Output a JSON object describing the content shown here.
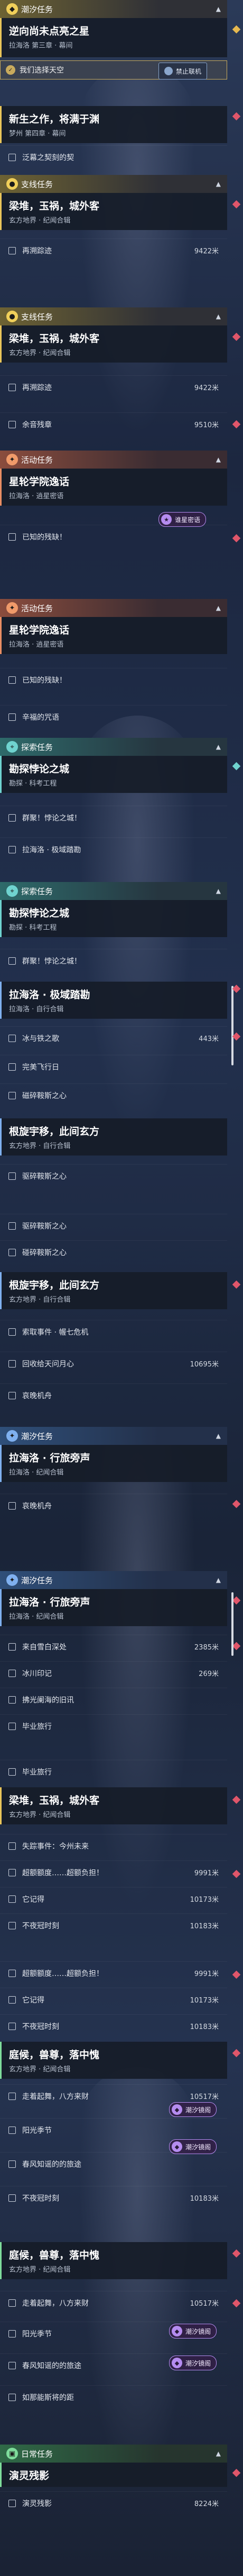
{
  "header_labels": {
    "main": "潮汐任务",
    "side": "支线任务",
    "event": "活动任务",
    "tidal": "潮汐任务",
    "explore": "探索任务",
    "daily": "日常任务"
  },
  "prohibited_label": "禁止联机",
  "tag_label": "谁星密语",
  "tide_tag_label": "潮汐镜阁",
  "quests": {
    "q1": {
      "title": "逆向尚未点亮之星",
      "sub": "拉海洛 第三章 · 幕间",
      "selected": "我们选择天空"
    },
    "q2": {
      "title": "新生之作，将满于渊",
      "sub": "梦州 第四章 · 幕间",
      "objs": [
        "泛幕之契刻的契"
      ]
    },
    "q3": {
      "title": "梁堆，玉祸，城外客",
      "sub": "玄方地界 · 纪闻合辑",
      "objs": [
        {
          "t": "再溯踪迹",
          "d": "9422米"
        }
      ]
    },
    "q4": {
      "title": "梁堆，玉祸，城外客",
      "sub": "玄方地界 · 纪闻合辑",
      "objs": [
        {
          "t": "再溯踪迹",
          "d": "9422米"
        },
        {
          "t": "余音残章",
          "d": "9510米"
        }
      ]
    },
    "q5": {
      "title": "星轮学院逸话",
      "sub": "拉海洛 · 逍星密语",
      "objs": [
        "已知的残缺！"
      ]
    },
    "q6": {
      "title": "星轮学院逸话",
      "sub": "拉海洛 · 逍星密语",
      "objs": [
        "已知的残缺！",
        "辛福的咒语"
      ]
    },
    "q7": {
      "title": "勘探悖论之城",
      "sub": "勘探 · 科考工程",
      "objs": [
        "群聚！悖论之城！",
        "拉海洛 · 极域踏勘"
      ]
    },
    "q8": {
      "title": "勘探悖论之城",
      "sub": "勘探 · 科考工程",
      "objs": [
        "群聚！悖论之城！"
      ]
    },
    "q9": {
      "title": "拉海洛 · 极域踏勘",
      "sub": "拉海洛 · 自行合辑",
      "objs": [
        {
          "t": "冰与铁之歌",
          "d": "443米"
        },
        {
          "t": "完美飞行日",
          "d": ""
        },
        {
          "t": "磁碎鞍斯之心",
          "d": ""
        }
      ]
    },
    "q10": {
      "title": "根旋宇移，此间玄方",
      "sub": "玄方地界 · 自行合辑",
      "objs": [
        "驱碎鞍斯之心",
        "碰碎鞍斯之心"
      ]
    },
    "q11": {
      "title": "根旋宇移，此间玄方",
      "sub": "玄方地界 · 自行合辑",
      "objs": [
        {
          "t": "索取事件 · 幄七危机",
          "d": ""
        },
        {
          "t": "回收给天问月心",
          "d": "10695米"
        },
        {
          "t": "哀晚机舟",
          "d": ""
        }
      ]
    },
    "q12": {
      "title": "拉海洛 · 行旅旁声",
      "sub": "拉海洛 · 纪闻合辑",
      "objs": [
        "哀晚机舟"
      ]
    },
    "q13": {
      "title": "拉海洛 · 行旅旁声",
      "sub": "拉海洛 · 纪闻合辑",
      "objs": [
        {
          "t": "来自雪白深处",
          "d": "2385米"
        },
        {
          "t": "冰川印记",
          "d": "269米"
        },
        {
          "t": "拂光阑海的旧讯",
          "d": ""
        },
        {
          "t": "毕业旅行",
          "d": ""
        }
      ]
    },
    "q14": {
      "title": "梁堆，玉祸，城外客",
      "sub": "玄方地界 · 纪闻合辑",
      "objs": [
        {
          "t": "毕业旅行",
          "d": ""
        },
        {
          "t": "失踪事件：今州未来",
          "d": ""
        },
        {
          "t": "超额额度……超额负担！",
          "d": "9991米"
        },
        {
          "t": "它记得",
          "d": "10173米"
        },
        {
          "t": "不夜冠时刻",
          "d": "10183米"
        }
      ]
    },
    "q15": {
      "title": "庭候，兽尊，落中愧",
      "sub": "玄方地界 · 纪闻合辑",
      "objs": [
        {
          "t": "超额额度……超额负担！",
          "d": "9991米"
        },
        {
          "t": "它记得",
          "d": "10173米"
        },
        {
          "t": "不夜冠时刻",
          "d": "10183米"
        }
      ]
    },
    "q16": {
      "title": "庭候，兽尊，落中愧",
      "sub": "玄方地界 · 纪闻合辑",
      "objs": [
        {
          "t": "走着起舞，八方来财",
          "d": "10517米"
        },
        {
          "t": "阳光季节",
          "d": ""
        },
        {
          "t": "春风知谣的的旅途",
          "d": ""
        },
        {
          "t": "不夜冠时刻",
          "d": "10183米"
        }
      ]
    },
    "q17": {
      "title": "庭候，兽尊，落中愧",
      "sub": "玄方地界 · 纪闻合辑",
      "objs": [
        {
          "t": "走着起舞，八方来财",
          "d": "10517米"
        },
        {
          "t": "阳光季节",
          "d": ""
        },
        {
          "t": "春风知谣的的旅途",
          "d": ""
        },
        {
          "t": "如那能斯将的距",
          "d": ""
        }
      ]
    },
    "q18": {
      "title": "演灵残影",
      "sub": "",
      "objs": [
        {
          "t": "演灵残影",
          "d": "8224米"
        }
      ]
    }
  }
}
